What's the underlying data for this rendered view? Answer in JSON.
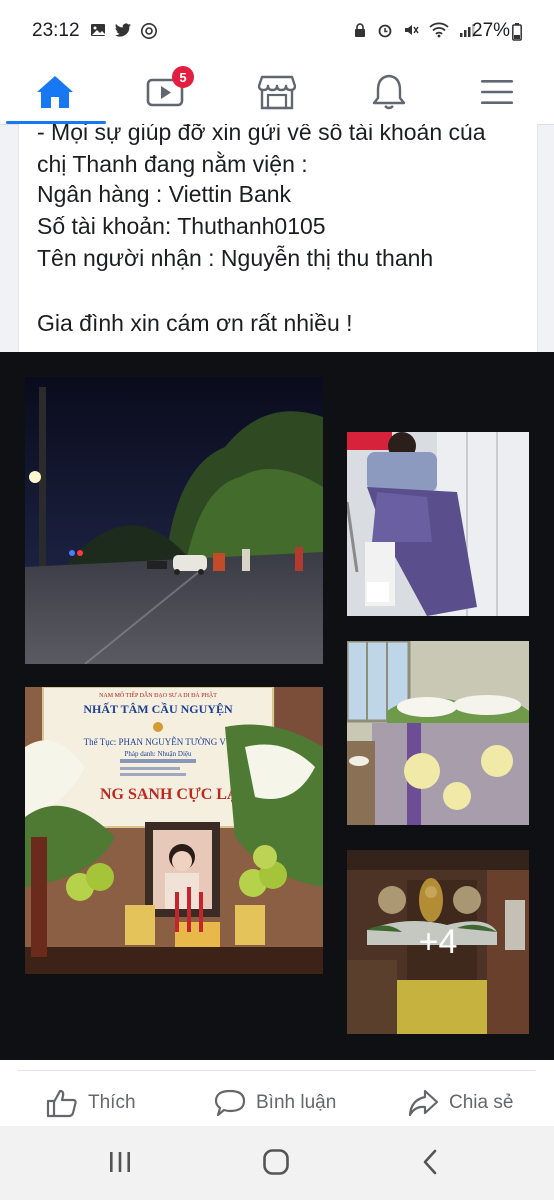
{
  "status_bar": {
    "time": "23:12",
    "left_icons": [
      "gallery-icon",
      "twitter-icon",
      "at-icon"
    ],
    "battery_text": "27%"
  },
  "nav": {
    "tabs": [
      "home",
      "watch",
      "marketplace",
      "notifications",
      "menu"
    ],
    "watch_badge": "5",
    "accent": "#1877f2"
  },
  "post": {
    "lines": [
      "- Mọi sự giúp đỡ xin gửi về số tài khoản của",
      "chị Thanh đang nằm viện :",
      "Ngân hàng : Viettin Bank",
      "Số tài khoản: Thuthanh0105",
      "Tên người nhận : Nguyễn thị thu thanh",
      "Gia đình xin cám ơn rất nhiều !"
    ]
  },
  "gallery": {
    "banner_top": "NAM MÔ TIẾP DẪN ĐẠO SƯ A DI ĐÀ PHẬT",
    "banner_title": "NHẤT TÂM CẦU NGUYỆN",
    "banner_name": "Thế Tục: PHAN NGUYỄN TƯỜNG VY",
    "banner_dharma": "Pháp danh: Nhuận Diệu",
    "banner_bottom": "NG SANH CỰC LẠC",
    "more_count": "+4"
  },
  "actions": {
    "like": "Thích",
    "comment": "Bình luận",
    "share": "Chia sẻ"
  }
}
